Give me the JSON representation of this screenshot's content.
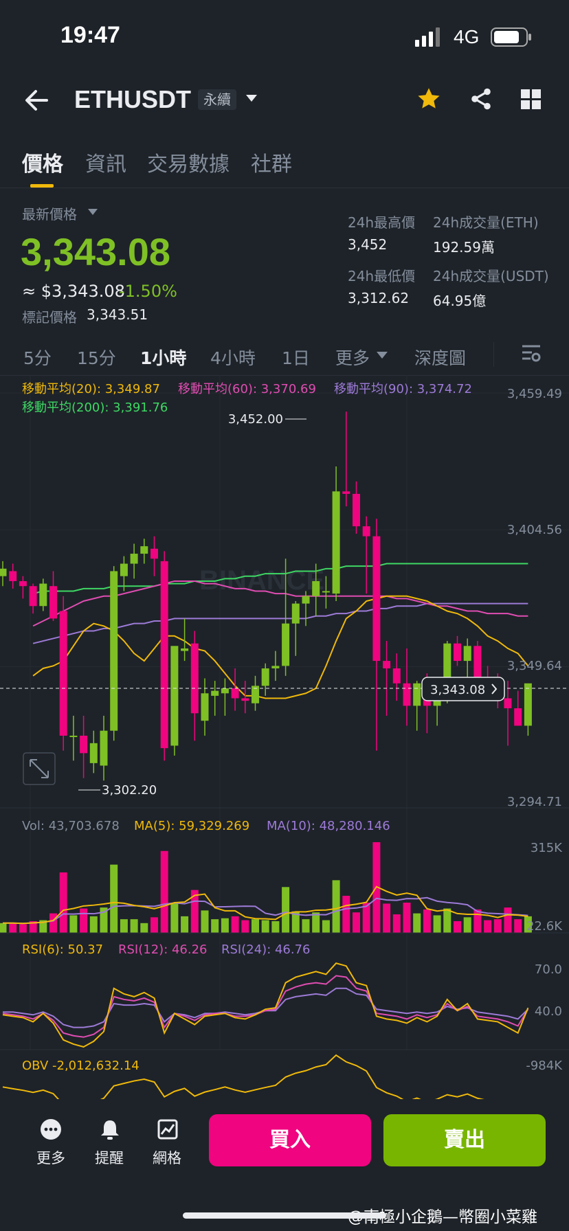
{
  "status_bar": {
    "time": "19:47",
    "network": "4G"
  },
  "header": {
    "symbol": "ETHUSDT",
    "contract_type": "永續"
  },
  "tabs": [
    {
      "label": "價格",
      "active": true
    },
    {
      "label": "資訊",
      "active": false
    },
    {
      "label": "交易數據",
      "active": false
    },
    {
      "label": "社群",
      "active": false
    }
  ],
  "price_panel": {
    "last_label": "最新價格",
    "last_price": "3,343.08",
    "usd_price": "≈ $3,343.08",
    "change_pct": "-1.50%",
    "mark_label": "標記價格",
    "mark_price": "3,343.51",
    "high_label": "24h最高價",
    "high_value": "3,452",
    "low_label": "24h最低價",
    "low_value": "3,312.62",
    "vol_eth_label": "24h成交量(ETH)",
    "vol_eth_value": "192.59萬",
    "vol_usdt_label": "24h成交量(USDT)",
    "vol_usdt_value": "64.95億"
  },
  "timeframes": [
    {
      "label": "5分",
      "active": false
    },
    {
      "label": "15分",
      "active": false
    },
    {
      "label": "1小時",
      "active": true
    },
    {
      "label": "4小時",
      "active": false
    },
    {
      "label": "1日",
      "active": false
    },
    {
      "label": "更多",
      "active": false
    },
    {
      "label": "深度圖",
      "active": false
    }
  ],
  "indicators": {
    "ma20": "移動平均(20): 3,349.87",
    "ma60": "移動平均(60): 3,370.69",
    "ma90": "移動平均(90): 3,374.72",
    "ma200": "移動平均(200): 3,391.76",
    "vol": "Vol: 43,703.678",
    "vol_ma5": "MA(5): 59,329.269",
    "vol_ma10": "MA(10): 48,280.146",
    "rsi6": "RSI(6): 50.37",
    "rsi12": "RSI(12): 46.26",
    "rsi24": "RSI(24): 46.76",
    "obv": "OBV -2,012,632.14"
  },
  "chart_data": {
    "type": "candlestick",
    "price_axis_labels": [
      "3,459.49",
      "3,404.56",
      "3,349.64",
      "3,294.71"
    ],
    "price_ylim": [
      3294.71,
      3459.49
    ],
    "max_label": "3,452.00",
    "min_label": "3,302.20",
    "current_price_label": "3,343.08",
    "current_price": 3343.08,
    "watermark": "BINANCE",
    "candles": [
      {
        "o": 3386,
        "h": 3392,
        "l": 3382,
        "c": 3389
      },
      {
        "o": 3388,
        "h": 3391,
        "l": 3381,
        "c": 3384
      },
      {
        "o": 3384,
        "h": 3386,
        "l": 3377,
        "c": 3382
      },
      {
        "o": 3382,
        "h": 3383,
        "l": 3371,
        "c": 3374
      },
      {
        "o": 3374,
        "h": 3385,
        "l": 3372,
        "c": 3383
      },
      {
        "o": 3382,
        "h": 3388,
        "l": 3368,
        "c": 3369
      },
      {
        "o": 3372,
        "h": 3378,
        "l": 3316,
        "c": 3322
      },
      {
        "o": 3322,
        "h": 3330,
        "l": 3312,
        "c": 3322
      },
      {
        "o": 3322,
        "h": 3330,
        "l": 3305,
        "c": 3315
      },
      {
        "o": 3311,
        "h": 3324,
        "l": 3307,
        "c": 3319
      },
      {
        "o": 3310,
        "h": 3330,
        "l": 3304,
        "c": 3324
      },
      {
        "o": 3324,
        "h": 3390,
        "l": 3320,
        "c": 3388
      },
      {
        "o": 3386,
        "h": 3394,
        "l": 3380,
        "c": 3391
      },
      {
        "o": 3391,
        "h": 3399,
        "l": 3385,
        "c": 3395
      },
      {
        "o": 3395,
        "h": 3401,
        "l": 3391,
        "c": 3398
      },
      {
        "o": 3397,
        "h": 3402,
        "l": 3386,
        "c": 3393
      },
      {
        "o": 3392,
        "h": 3396,
        "l": 3312,
        "c": 3317
      },
      {
        "o": 3318,
        "h": 3345,
        "l": 3314,
        "c": 3358
      },
      {
        "o": 3356,
        "h": 3369,
        "l": 3352,
        "c": 3357
      },
      {
        "o": 3359,
        "h": 3364,
        "l": 3320,
        "c": 3331
      },
      {
        "o": 3328,
        "h": 3345,
        "l": 3322,
        "c": 3339
      },
      {
        "o": 3338,
        "h": 3344,
        "l": 3330,
        "c": 3340
      },
      {
        "o": 3339,
        "h": 3345,
        "l": 3330,
        "c": 3341
      },
      {
        "o": 3341,
        "h": 3349,
        "l": 3332,
        "c": 3337
      },
      {
        "o": 3337,
        "h": 3344,
        "l": 3331,
        "c": 3336
      },
      {
        "o": 3335,
        "h": 3346,
        "l": 3332,
        "c": 3342
      },
      {
        "o": 3342,
        "h": 3351,
        "l": 3338,
        "c": 3349
      },
      {
        "o": 3349,
        "h": 3356,
        "l": 3344,
        "c": 3350
      },
      {
        "o": 3350,
        "h": 3393,
        "l": 3346,
        "c": 3367
      },
      {
        "o": 3367,
        "h": 3376,
        "l": 3354,
        "c": 3375
      },
      {
        "o": 3375,
        "h": 3380,
        "l": 3366,
        "c": 3378
      },
      {
        "o": 3378,
        "h": 3391,
        "l": 3370,
        "c": 3384
      },
      {
        "o": 3380,
        "h": 3386,
        "l": 3373,
        "c": 3380
      },
      {
        "o": 3379,
        "h": 3430,
        "l": 3376,
        "c": 3420
      },
      {
        "o": 3420,
        "h": 3452,
        "l": 3414,
        "c": 3419
      },
      {
        "o": 3419,
        "h": 3424,
        "l": 3403,
        "c": 3406
      },
      {
        "o": 3406,
        "h": 3410,
        "l": 3379,
        "c": 3402
      },
      {
        "o": 3402,
        "h": 3409,
        "l": 3316,
        "c": 3352
      },
      {
        "o": 3352,
        "h": 3360,
        "l": 3330,
        "c": 3349
      },
      {
        "o": 3349,
        "h": 3355,
        "l": 3336,
        "c": 3343
      },
      {
        "o": 3343,
        "h": 3357,
        "l": 3326,
        "c": 3334
      },
      {
        "o": 3334,
        "h": 3344,
        "l": 3324,
        "c": 3343
      },
      {
        "o": 3343,
        "h": 3347,
        "l": 3323,
        "c": 3334
      },
      {
        "o": 3334,
        "h": 3344,
        "l": 3326,
        "c": 3342
      },
      {
        "o": 3342,
        "h": 3360,
        "l": 3335,
        "c": 3359
      },
      {
        "o": 3359,
        "h": 3362,
        "l": 3350,
        "c": 3352
      },
      {
        "o": 3352,
        "h": 3361,
        "l": 3345,
        "c": 3358
      },
      {
        "o": 3358,
        "h": 3360,
        "l": 3336,
        "c": 3344
      },
      {
        "o": 3344,
        "h": 3350,
        "l": 3337,
        "c": 3341
      },
      {
        "o": 3341,
        "h": 3347,
        "l": 3333,
        "c": 3337
      },
      {
        "o": 3337,
        "h": 3344,
        "l": 3318,
        "c": 3333
      },
      {
        "o": 3333,
        "h": 3340,
        "l": 3326,
        "c": 3326
      },
      {
        "o": 3326,
        "h": 3339,
        "l": 3322,
        "c": 3343
      }
    ],
    "ma20": [
      3346,
      3349,
      3350,
      3352,
      3358,
      3364,
      3367,
      3366,
      3364,
      3360,
      3355,
      3352,
      3357,
      3362,
      3362,
      3360,
      3357,
      3356,
      3352,
      3347,
      3342,
      3338,
      3338,
      3337,
      3337,
      3337,
      3338,
      3339,
      3341,
      3350,
      3360,
      3369,
      3372,
      3376,
      3377,
      3378,
      3378,
      3378,
      3377,
      3376,
      3374,
      3372,
      3371,
      3369,
      3366,
      3362,
      3360,
      3357,
      3355,
      3350
    ],
    "ma60": [
      3366,
      3368,
      3370,
      3372,
      3374,
      3376,
      3377,
      3378,
      3378,
      3379,
      3380,
      3381,
      3382,
      3383,
      3384,
      3384,
      3384,
      3383,
      3383,
      3382,
      3381,
      3381,
      3380,
      3380,
      3379,
      3379,
      3378,
      3378,
      3378,
      3378,
      3378,
      3378,
      3378,
      3378,
      3378,
      3378,
      3377,
      3377,
      3376,
      3375,
      3374,
      3374,
      3373,
      3372,
      3372,
      3371,
      3371,
      3371,
      3370,
      3370
    ],
    "ma90": [
      3359,
      3360,
      3361,
      3362,
      3363,
      3364,
      3364,
      3365,
      3365,
      3366,
      3367,
      3367,
      3368,
      3368,
      3369,
      3369,
      3369,
      3369,
      3369,
      3369,
      3369,
      3369,
      3369,
      3369,
      3369,
      3369,
      3369,
      3369,
      3370,
      3370,
      3371,
      3371,
      3372,
      3372,
      3373,
      3373,
      3374,
      3374,
      3374,
      3375,
      3375,
      3375,
      3375,
      3375,
      3375,
      3375,
      3375,
      3375,
      3375,
      3375
    ],
    "ma200": [
      3379,
      3380,
      3380,
      3380,
      3380,
      3381,
      3381,
      3381,
      3382,
      3382,
      3382,
      3382,
      3382,
      3383,
      3383,
      3383,
      3384,
      3384,
      3384,
      3385,
      3385,
      3386,
      3386,
      3387,
      3387,
      3387,
      3388,
      3388,
      3388,
      3389,
      3389,
      3390,
      3390,
      3390,
      3390,
      3391,
      3391,
      3391,
      3391,
      3391,
      3391,
      3391,
      3391,
      3391,
      3391,
      3391,
      3391,
      3391,
      3391,
      3391
    ],
    "volume_axis_labels": [
      "315K",
      "22.6K"
    ],
    "volume_ylim": [
      22600,
      315000
    ],
    "rsi_axis_labels": [
      "70.0",
      "40.0"
    ],
    "rsi_ylim": [
      20,
      85
    ],
    "rsi6": [
      43,
      42,
      41,
      38,
      44,
      37,
      25,
      22,
      20,
      24,
      31,
      62,
      58,
      56,
      59,
      55,
      30,
      44,
      40,
      36,
      42,
      43,
      44,
      41,
      40,
      43,
      47,
      48,
      66,
      70,
      72,
      74,
      72,
      80,
      78,
      66,
      64,
      42,
      40,
      39,
      37,
      41,
      38,
      42,
      54,
      46,
      51,
      40,
      39,
      38,
      34,
      30,
      48
    ],
    "rsi12": [
      44,
      43,
      42,
      40,
      44,
      39,
      30,
      28,
      27,
      29,
      34,
      56,
      54,
      53,
      55,
      52,
      34,
      44,
      42,
      39,
      43,
      44,
      44,
      42,
      42,
      43,
      46,
      47,
      60,
      63,
      65,
      66,
      65,
      71,
      70,
      62,
      60,
      44,
      43,
      42,
      40,
      43,
      41,
      43,
      51,
      46,
      49,
      42,
      41,
      40,
      38,
      35,
      47
    ],
    "rsi24": [
      45,
      45,
      44,
      43,
      45,
      42,
      36,
      34,
      34,
      35,
      38,
      51,
      50,
      50,
      51,
      50,
      38,
      44,
      43,
      41,
      44,
      44,
      45,
      44,
      43,
      44,
      46,
      46,
      54,
      56,
      57,
      58,
      57,
      62,
      62,
      58,
      57,
      47,
      46,
      45,
      44,
      45,
      44,
      45,
      49,
      47,
      48,
      45,
      44,
      43,
      42,
      40,
      47
    ],
    "obv_axis_label": "-984K"
  },
  "bottom_nav": [
    {
      "label": "更多",
      "icon": "more-dots-icon"
    },
    {
      "label": "提醒",
      "icon": "bell-icon"
    },
    {
      "label": "網格",
      "icon": "grid-chart-icon"
    }
  ],
  "buy_label": "買入",
  "sell_label": "賣出",
  "watermark_text": "@南極小企鵝—幣圈小菜雞",
  "colors": {
    "up": "#7fc025",
    "down": "#f0047f",
    "accent": "#f0b90b",
    "ma20": "#f0b90b",
    "ma60": "#e04db2",
    "ma90": "#9d7bd8",
    "ma200": "#3ed964"
  }
}
